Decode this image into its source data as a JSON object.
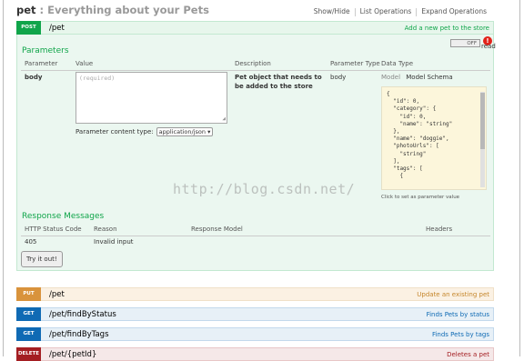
{
  "header": {
    "resource": "pet",
    "separator": " : ",
    "description": "Everything about your Pets",
    "links": [
      "Show/Hide",
      "List Operations",
      "Expand Operations"
    ]
  },
  "post_op": {
    "method": "POST",
    "path": "/pet",
    "summary": "Add a new pet to the store",
    "parameters_title": "Parameters",
    "toggle_label": "OFF",
    "error_badge": "!",
    "read_label": "read",
    "param_columns": [
      "Parameter",
      "Value",
      "Description",
      "Parameter Type",
      "Data Type"
    ],
    "param": {
      "name": "body",
      "placeholder": "(required)",
      "description": "Pet object that needs to be added to the store",
      "type": "body",
      "content_type_label": "Parameter content type:",
      "content_type_value": "application/json ▾"
    },
    "data_type_tabs": [
      "Model",
      "Model Schema"
    ],
    "model_schema": "{\n  \"id\": 0,\n  \"category\": {\n    \"id\": 0,\n    \"name\": \"string\"\n  },\n  \"name\": \"doggie\",\n  \"photoUrls\": [\n    \"string\"\n  ],\n  \"tags\": [\n    {",
    "click_hint": "Click to set as parameter value",
    "responses_title": "Response Messages",
    "response_columns": [
      "HTTP Status Code",
      "Reason",
      "Response Model",
      "Headers"
    ],
    "responses": [
      {
        "code": "405",
        "reason": "Invalid input"
      }
    ],
    "try_button": "Try it out!"
  },
  "other_ops": [
    {
      "method": "PUT",
      "path": "/pet",
      "summary": "Update an existing pet"
    },
    {
      "method": "GET",
      "path": "/pet/findByStatus",
      "summary": "Finds Pets by status"
    },
    {
      "method": "GET",
      "path": "/pet/findByTags",
      "summary": "Finds Pets by tags"
    },
    {
      "method": "DELETE",
      "path": "/pet/{petId}",
      "summary": "Deletes a pet"
    }
  ],
  "watermark": "http://blog.csdn.net/"
}
